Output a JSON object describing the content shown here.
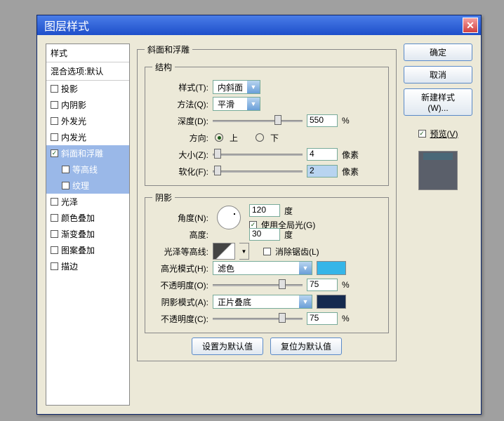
{
  "title": "图层样式",
  "sidebar": {
    "header": "样式",
    "blending": "混合选项:默认",
    "items": [
      {
        "label": "投影",
        "checked": false
      },
      {
        "label": "内阴影",
        "checked": false
      },
      {
        "label": "外发光",
        "checked": false
      },
      {
        "label": "内发光",
        "checked": false
      },
      {
        "label": "斜面和浮雕",
        "checked": true,
        "selected": true
      },
      {
        "label": "等高线",
        "checked": false,
        "child": true,
        "selected": true
      },
      {
        "label": "纹理",
        "checked": false,
        "child": true,
        "selected": true
      },
      {
        "label": "光泽",
        "checked": false
      },
      {
        "label": "颜色叠加",
        "checked": false
      },
      {
        "label": "渐变叠加",
        "checked": false
      },
      {
        "label": "图案叠加",
        "checked": false
      },
      {
        "label": "描边",
        "checked": false
      }
    ]
  },
  "section": {
    "name": "斜面和浮雕",
    "structure": {
      "legend": "结构",
      "style_label": "样式(T):",
      "style_value": "内斜面",
      "method_label": "方法(Q):",
      "method_value": "平滑",
      "depth_label": "深度(D):",
      "depth_value": "550",
      "pct": "%",
      "direction_label": "方向:",
      "up": "上",
      "down": "下",
      "size_label": "大小(Z):",
      "size_value": "4",
      "px": "像素",
      "soften_label": "软化(F):",
      "soften_value": "2"
    },
    "shading": {
      "legend": "阴影",
      "angle_label": "角度(N):",
      "angle_value": "120",
      "deg": "度",
      "use_global": "使用全局光(G)",
      "altitude_label": "高度:",
      "altitude_value": "30",
      "contour_label": "光泽等高线:",
      "anti_alias": "消除锯齿(L)",
      "highlight_mode_label": "高光模式(H):",
      "highlight_mode_value": "滤色",
      "highlight_color": "#35b5e8",
      "opacity1_label": "不透明度(O):",
      "opacity1_value": "75",
      "shadow_mode_label": "阴影模式(A):",
      "shadow_mode_value": "正片叠底",
      "shadow_color": "#152a4f",
      "opacity2_label": "不透明度(C):",
      "opacity2_value": "75"
    },
    "buttons": {
      "set_default": "设置为默认值",
      "reset_default": "复位为默认值"
    }
  },
  "actions": {
    "ok": "确定",
    "cancel": "取消",
    "new_style": "新建样式(W)...",
    "preview": "预览(V)"
  }
}
